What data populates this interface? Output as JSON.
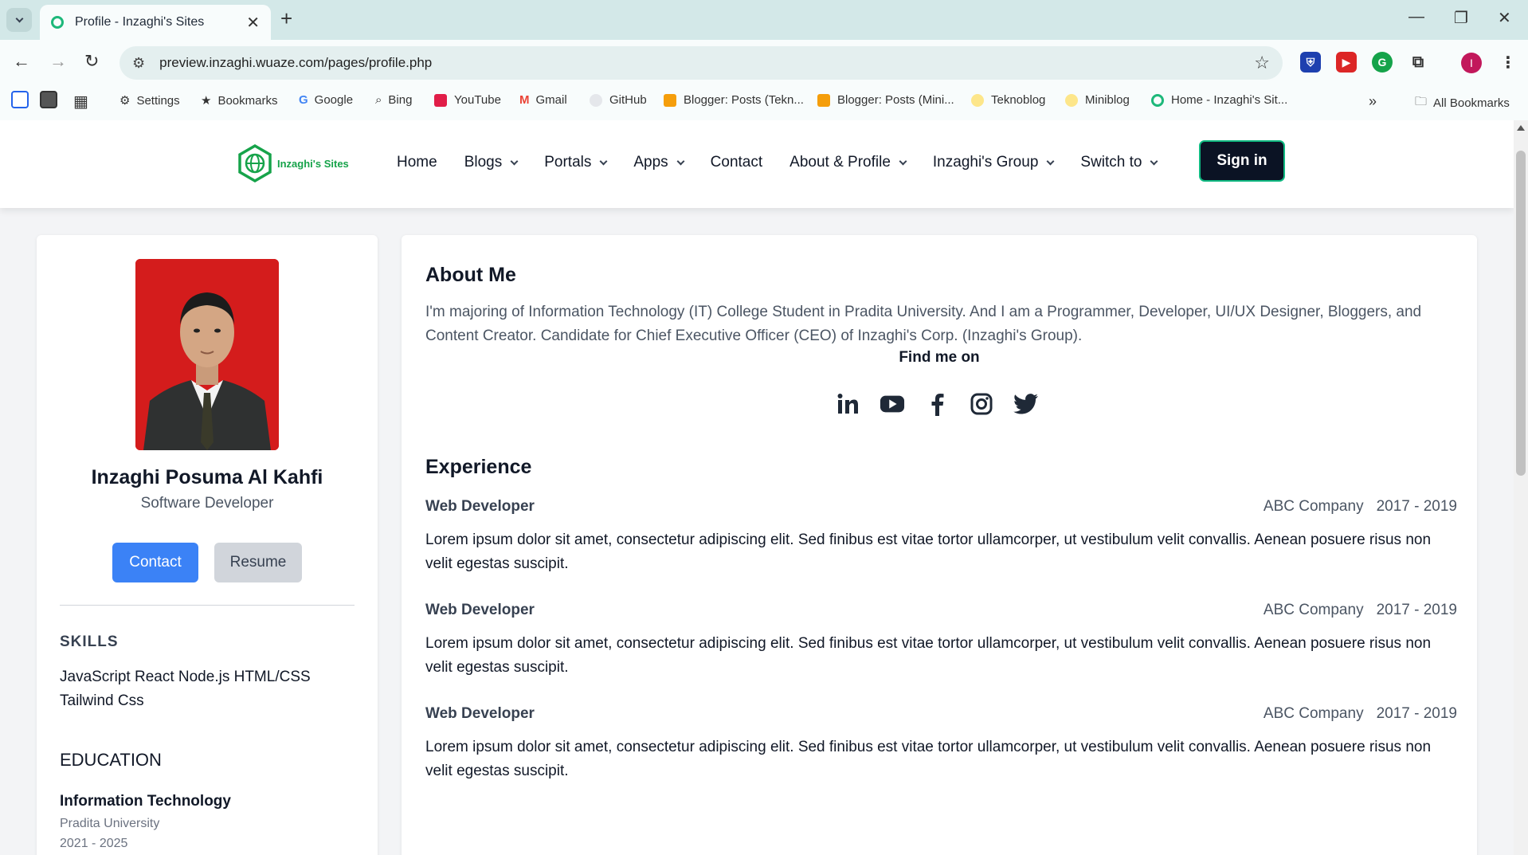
{
  "browser": {
    "tab_title": "Profile - Inzaghi's Sites",
    "url": "preview.inzaghi.wuaze.com/pages/profile.php",
    "profile_initial": "I",
    "bookmarks": [
      {
        "label": "Settings",
        "icon": "gear-icon"
      },
      {
        "label": "Bookmarks",
        "icon": "star-icon"
      },
      {
        "label": "Google",
        "icon": "google-icon"
      },
      {
        "label": "Bing",
        "icon": "search-icon"
      },
      {
        "label": "YouTube",
        "icon": "youtube-icon"
      },
      {
        "label": "Gmail",
        "icon": "gmail-icon"
      },
      {
        "label": "GitHub",
        "icon": "github-icon"
      },
      {
        "label": "Blogger: Posts (Tekn...",
        "icon": "blogger-icon"
      },
      {
        "label": "Blogger: Posts (Mini...",
        "icon": "blogger-icon"
      },
      {
        "label": "Teknoblog",
        "icon": "site-icon"
      },
      {
        "label": "Miniblog",
        "icon": "site-icon"
      },
      {
        "label": "Home - Inzaghi's Sit...",
        "icon": "site-icon"
      }
    ],
    "all_bookmarks": "All Bookmarks"
  },
  "site": {
    "logo_text": "Inzaghi's Sites",
    "menu": [
      {
        "label": "Home",
        "dropdown": false
      },
      {
        "label": "Blogs",
        "dropdown": true
      },
      {
        "label": "Portals",
        "dropdown": true
      },
      {
        "label": "Apps",
        "dropdown": true
      },
      {
        "label": "Contact",
        "dropdown": false
      },
      {
        "label": "About & Profile",
        "dropdown": true
      },
      {
        "label": "Inzaghi's Group",
        "dropdown": true
      },
      {
        "label": "Switch to",
        "dropdown": true
      }
    ],
    "sign_in": "Sign in"
  },
  "profile": {
    "name": "Inzaghi Posuma Al Kahfi",
    "title": "Software Developer",
    "contact_button": "Contact",
    "resume_button": "Resume",
    "skills_heading": "SKILLS",
    "skills": "JavaScript React Node.js HTML/CSS Tailwind Css",
    "education_heading": "EDUCATION",
    "education": {
      "degree": "Information Technology",
      "school": "Pradita University",
      "years": "2021 - 2025"
    }
  },
  "about": {
    "heading": "About Me",
    "text": "I'm majoring of Information Technology (IT) College Student in Pradita University. And I am a Programmer, Developer, UI/UX Designer, Bloggers, and Content Creator. Candidate for Chief Executive Officer (CEO) of Inzaghi's Corp. (Inzaghi's Group).",
    "find_me": "Find me on",
    "socials": [
      "linkedin-icon",
      "youtube-icon",
      "facebook-icon",
      "instagram-icon",
      "twitter-icon"
    ]
  },
  "experience": {
    "heading": "Experience",
    "items": [
      {
        "role": "Web Developer",
        "company": "ABC Company",
        "years": "2017 - 2019",
        "desc": "Lorem ipsum dolor sit amet, consectetur adipiscing elit. Sed finibus est vitae tortor ullamcorper, ut vestibulum velit convallis. Aenean posuere risus non velit egestas suscipit."
      },
      {
        "role": "Web Developer",
        "company": "ABC Company",
        "years": "2017 - 2019",
        "desc": "Lorem ipsum dolor sit amet, consectetur adipiscing elit. Sed finibus est vitae tortor ullamcorper, ut vestibulum velit convallis. Aenean posuere risus non velit egestas suscipit."
      },
      {
        "role": "Web Developer",
        "company": "ABC Company",
        "years": "2017 - 2019",
        "desc": "Lorem ipsum dolor sit amet, consectetur adipiscing elit. Sed finibus est vitae tortor ullamcorper, ut vestibulum velit convallis. Aenean posuere risus non velit egestas suscipit."
      }
    ]
  },
  "colors": {
    "brand_green": "#16a34a",
    "primary_blue": "#3b82f6",
    "sign_in_bg": "#0b1324"
  }
}
